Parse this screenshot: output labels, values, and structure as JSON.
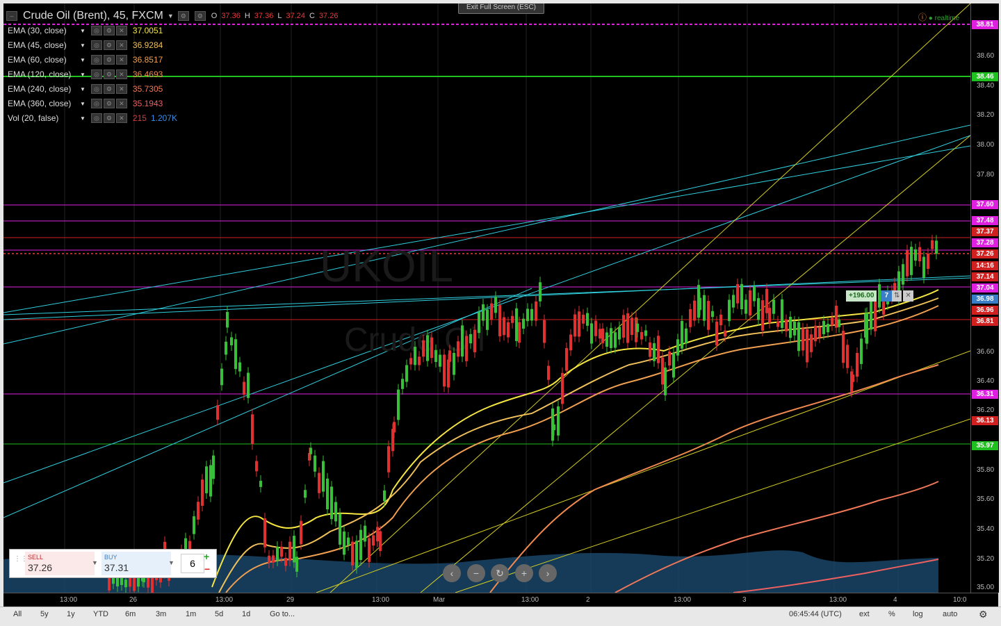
{
  "header": {
    "symbol": "Crude Oil (Brent), 45, FXCM",
    "o_label": "O",
    "o": "37.36",
    "h_label": "H",
    "h": "37.36",
    "l_label": "L",
    "l": "37.24",
    "c_label": "C",
    "c": "37.26",
    "exit_fullscreen": "Exit Full Screen (ESC)",
    "realtime": "realtime"
  },
  "indicators": [
    {
      "name": "EMA (30, close)",
      "value": "37.0051",
      "color": "#f5e642"
    },
    {
      "name": "EMA (45, close)",
      "value": "36.9284",
      "color": "#f0c05a"
    },
    {
      "name": "EMA (60, close)",
      "value": "36.8517",
      "color": "#f0a050"
    },
    {
      "name": "EMA (120, close)",
      "value": "36.4693",
      "color": "#f08a50"
    },
    {
      "name": "EMA (240, close)",
      "value": "35.7305",
      "color": "#f07858"
    },
    {
      "name": "EMA (360, close)",
      "value": "35.1943",
      "color": "#ee6060"
    },
    {
      "name": "Vol (20, false)",
      "value": "215",
      "value2": "1.207K",
      "color": "#d24040",
      "color2": "#3a8ee6"
    }
  ],
  "price_axis": {
    "ticks": [
      "38.60",
      "38.40",
      "38.20",
      "38.00",
      "37.80",
      "36.60",
      "36.40",
      "36.20",
      "35.80",
      "35.60",
      "35.40",
      "35.20",
      "35.00"
    ],
    "labels": [
      {
        "text": "38.81",
        "color": "#e020e0"
      },
      {
        "text": "38.46",
        "color": "#20c020"
      },
      {
        "text": "37.60",
        "color": "#e020e0"
      },
      {
        "text": "37.48",
        "color": "#e020e0"
      },
      {
        "text": "37.37",
        "color": "#d02020"
      },
      {
        "text": "37.28",
        "color": "#e020e0"
      },
      {
        "text": "37.26",
        "color": "#d02020"
      },
      {
        "text": "14:16",
        "color": "#d02020"
      },
      {
        "text": "37.14",
        "color": "#d02020"
      },
      {
        "text": "37.04",
        "color": "#e020e0"
      },
      {
        "text": "36.98",
        "color": "#3a7ec8"
      },
      {
        "text": "36.96",
        "color": "#d02020"
      },
      {
        "text": "36.81",
        "color": "#d02020"
      },
      {
        "text": "36.31",
        "color": "#e020e0"
      },
      {
        "text": "36.13",
        "color": "#d02020"
      },
      {
        "text": "35.97",
        "color": "#20c020"
      }
    ]
  },
  "time_axis": [
    "13:00",
    "26",
    "13:00",
    "29",
    "13:00",
    "Mar",
    "13:00",
    "2",
    "13:00",
    "3",
    "13:00",
    "4",
    "10:0"
  ],
  "trade_panel": {
    "sell_label": "SELL",
    "sell_price": "37.26",
    "buy_label": "BUY",
    "buy_price": "37.31",
    "quantity": "6",
    "plus": "+",
    "minus": "−"
  },
  "position": {
    "pnl": "+196.00",
    "qty": "7"
  },
  "bottom_bar": {
    "ranges": [
      "All",
      "5y",
      "1y",
      "YTD",
      "6m",
      "3m",
      "1m",
      "5d",
      "1d"
    ],
    "goto": "Go to...",
    "time": "06:45:44 (UTC)",
    "options": [
      "ext",
      "%",
      "log",
      "auto"
    ]
  },
  "watermark": {
    "symbol": "UKOIL",
    "name": "Crude Oil"
  }
}
